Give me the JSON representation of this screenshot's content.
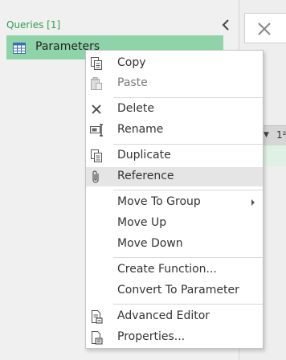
{
  "queries_pane": {
    "header": "Queries [1]",
    "items": [
      {
        "label": "Parameters",
        "icon": "table-icon"
      }
    ]
  },
  "column_header": {
    "type_label": "1²"
  },
  "context_menu": {
    "items": [
      {
        "label": "Copy",
        "icon": "copy-icon",
        "enabled": true
      },
      {
        "label": "Paste",
        "icon": "paste-icon",
        "enabled": false
      },
      {
        "label": "Delete",
        "icon": "delete-icon",
        "enabled": true
      },
      {
        "label": "Rename",
        "icon": "rename-icon",
        "enabled": true
      },
      {
        "label": "Duplicate",
        "icon": "duplicate-icon",
        "enabled": true
      },
      {
        "label": "Reference",
        "icon": "reference-icon",
        "enabled": true,
        "highlighted": true
      },
      {
        "label": "Move To Group",
        "has_submenu": true,
        "enabled": true
      },
      {
        "label": "Move Up",
        "enabled": true
      },
      {
        "label": "Move Down",
        "enabled": true
      },
      {
        "label": "Create Function...",
        "enabled": true
      },
      {
        "label": "Convert To Parameter",
        "enabled": true
      },
      {
        "label": "Advanced Editor",
        "icon": "advanced-editor-icon",
        "enabled": true
      },
      {
        "label": "Properties...",
        "icon": "properties-icon",
        "enabled": true
      }
    ]
  },
  "colors": {
    "accent_green": "#2e9e4f",
    "selected_query_bg": "#8ed4a8",
    "menu_hover_bg": "#e5e5e5"
  }
}
